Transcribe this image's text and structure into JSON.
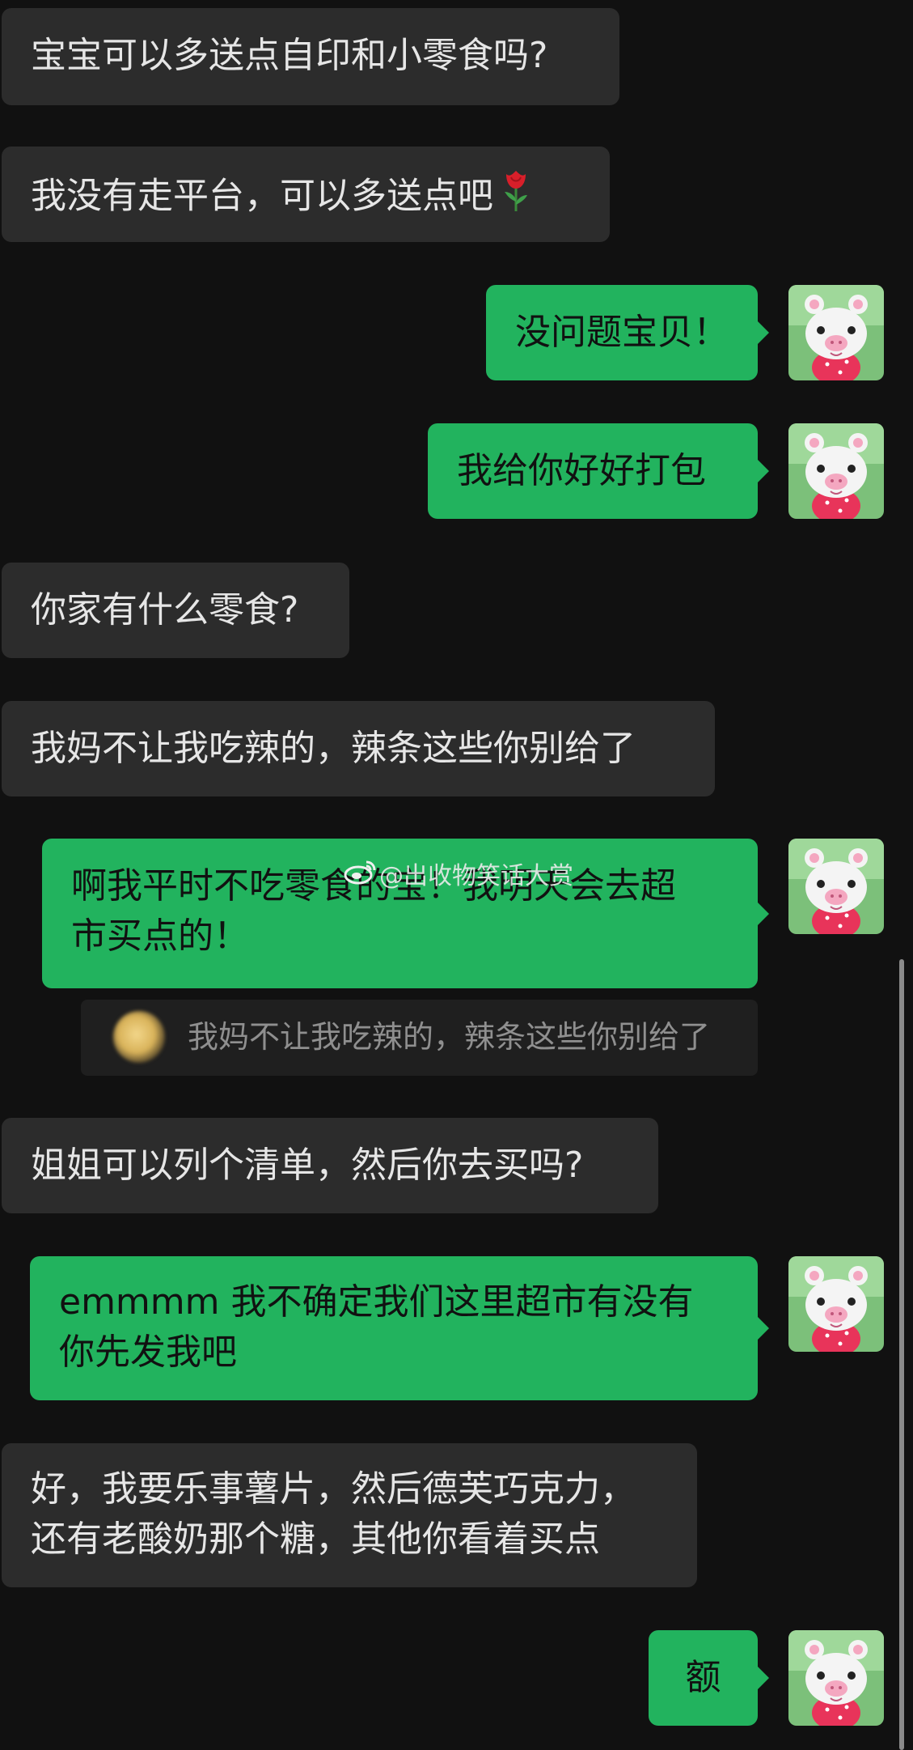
{
  "chat": {
    "messages": [
      {
        "side": "in",
        "text": "宝宝可以多送点自印和小零食吗?"
      },
      {
        "side": "in",
        "text": "我没有走平台，可以多送点吧",
        "emoji": "rose-icon"
      },
      {
        "side": "out",
        "text": "没问题宝贝！"
      },
      {
        "side": "out",
        "text": "我给你好好打包"
      },
      {
        "side": "in",
        "text": "你家有什么零食?"
      },
      {
        "side": "in",
        "text": "我妈不让我吃辣的，辣条这些你别给了"
      },
      {
        "side": "out",
        "lines": [
          "啊我平时不吃零食的宝！我明天会去超",
          "市买点的！"
        ]
      },
      {
        "side": "in",
        "text": "姐姐可以列个清单，然后你去买吗?"
      },
      {
        "side": "out",
        "lines": [
          "emmmm 我不确定我们这里超市有没有",
          "你先发我吧"
        ]
      },
      {
        "side": "in",
        "lines": [
          "好，我要乐事薯片，然后德芙巧克力，",
          "还有老酸奶那个糖，其他你看着买点"
        ]
      },
      {
        "side": "out",
        "text": "额"
      }
    ],
    "quote": {
      "text": "我妈不让我吃辣的，辣条这些你别给了"
    }
  },
  "watermark": {
    "text": "@出收物笑话大赏",
    "icon": "weibo-icon"
  },
  "colors": {
    "background": "#111111",
    "incoming_bubble": "#2c2c2c",
    "outgoing_bubble": "#22b35e"
  }
}
